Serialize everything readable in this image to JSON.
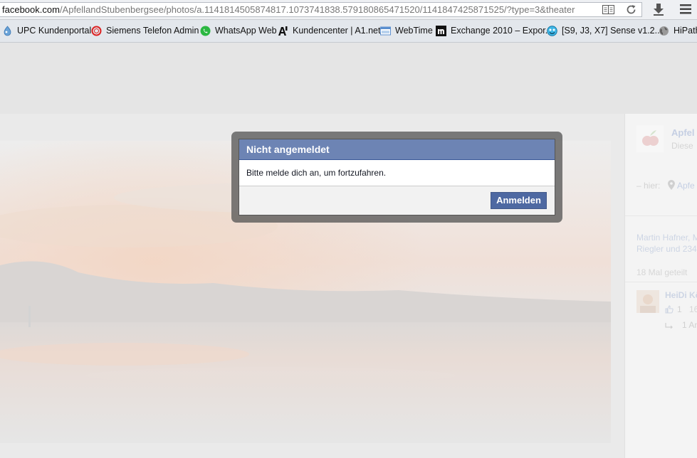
{
  "browser": {
    "url_host": "facebook.com",
    "url_path": "/ApfellandStubenbergsee/photos/a.1141814505874817.1073741838.579180865471520/1141847425871525/?type=3&theater",
    "reader_icon": "reader-view-icon",
    "reload_icon": "reload-icon",
    "download_icon": "download-arrow-icon",
    "menu_icon": "hamburger-menu-icon"
  },
  "bookmarks": [
    {
      "label": "UPC Kundenportal",
      "icon": "upc-icon"
    },
    {
      "label": "Siemens Telefon Admin",
      "icon": "siemens-icon"
    },
    {
      "label": "WhatsApp Web",
      "icon": "whatsapp-icon"
    },
    {
      "label": "Kundencenter | A1.net",
      "icon": "a1-icon"
    },
    {
      "label": "WebTime",
      "icon": "webtime-icon"
    },
    {
      "label": "Exchange 2010 – Expor...",
      "icon": "exchange-icon"
    },
    {
      "label": "[S9, J3, X7] Sense v1.2....",
      "icon": "smiley-icon"
    },
    {
      "label": "HiPath",
      "icon": "globe-icon"
    }
  ],
  "sidebar": {
    "page_name": "Apfel",
    "page_sub": "Diese",
    "at_label": "– hier:",
    "place": "Apfe",
    "likes_line1": "Martin Hafner, M",
    "likes_line2": "Riegler und 234",
    "shared": "18 Mal geteilt",
    "comment_author": "HeiDi Kö",
    "comment_likes": "1",
    "comment_time": "16",
    "reply_text": "1 An"
  },
  "dialog": {
    "title": "Nicht angemeldet",
    "message": "Bitte melde dich an, um fortzufahren.",
    "button_label": "Anmelden"
  },
  "colors": {
    "fb_header": "#6d84b4",
    "fb_button": "#4e69a2",
    "whatsapp": "#25d366"
  }
}
